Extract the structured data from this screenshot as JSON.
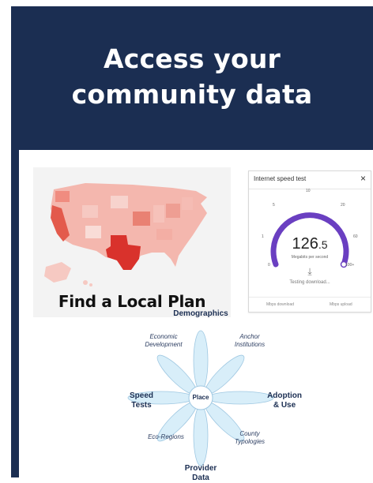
{
  "header": {
    "line1": "Access your",
    "line2": "community data"
  },
  "map_tile": {
    "label": "Find a Local Plan",
    "highlight_color": "#d9322c"
  },
  "speed_test": {
    "title": "Internet speed test",
    "close_glyph": "×",
    "value_main": "126",
    "value_decimal": ".5",
    "unit": "Megabits per second",
    "status": "Testing download...",
    "ticks": [
      "0",
      "1",
      "5",
      "10",
      "20",
      "60",
      "100+"
    ],
    "footer_left": "Mbps download",
    "footer_right": "Mbps upload",
    "accent_color": "#6a3fc1",
    "download_icon": "download-arrow-icon"
  },
  "diagram": {
    "center": "Place",
    "top": "Demographics",
    "bottom_line1": "Provider",
    "bottom_line2": "Data",
    "left_line1": "Speed",
    "left_line2": "Tests",
    "right_line1": "Adoption",
    "right_line2": "& Use",
    "upper_left_line1": "Economic",
    "upper_left_line2": "Development",
    "upper_right_line1": "Anchor",
    "upper_right_line2": "Institutions",
    "lower_left": "Eco-Regions",
    "lower_right_line1": "County",
    "lower_right_line2": "Typologies"
  }
}
